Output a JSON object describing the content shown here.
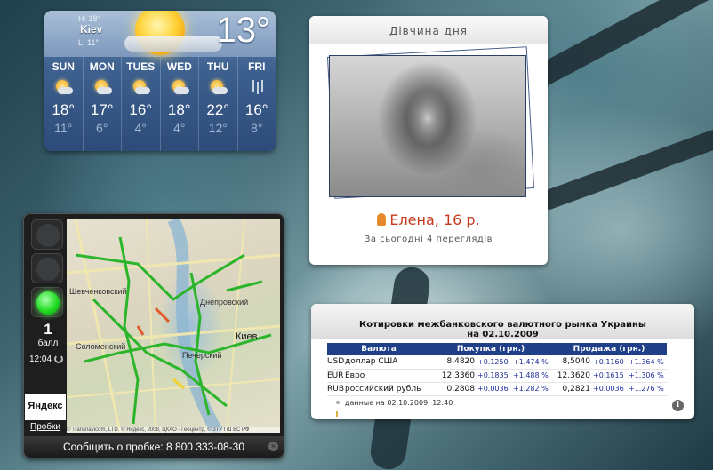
{
  "weather": {
    "high": "H: 18°",
    "city": "Kiev",
    "low": "L: 11°",
    "current_temp": "13°",
    "days": [
      {
        "name": "SUN",
        "icon": "sun-cloud-icon",
        "hi": "18°",
        "lo": "11°"
      },
      {
        "name": "MON",
        "icon": "sun-cloud-icon",
        "hi": "17°",
        "lo": "6°"
      },
      {
        "name": "TUES",
        "icon": "sun-cloud-icon",
        "hi": "16°",
        "lo": "4°"
      },
      {
        "name": "WED",
        "icon": "sun-cloud-icon",
        "hi": "18°",
        "lo": "4°"
      },
      {
        "name": "THU",
        "icon": "sun-cloud-icon",
        "hi": "22°",
        "lo": "12°"
      },
      {
        "name": "FRI",
        "icon": "rain-icon",
        "hi": "16°",
        "lo": "8°"
      }
    ]
  },
  "girl": {
    "title": "Дівчина дня",
    "name": "Елена, 16 р.",
    "views": "За сьогодні 4 переглядів"
  },
  "traffic": {
    "score": "1",
    "score_label": "балл",
    "time": "12:04",
    "yandex_logo": "Яндекс",
    "probki_link": "Пробки",
    "report": "Сообщить о пробке: 8 800 333-08-30",
    "map_labels": {
      "city": "Киев",
      "dneprovsky": "Днепровский",
      "pechersky": "Печерский",
      "solomensky": "Соломенский",
      "shevchenkovsky": "Шевченковский"
    },
    "map_copyright": "© Transnavicom, LTD. © Яндекс, 2008, ЦКАО - Геоцентр, © ЗТУ ГШ ВС РФ"
  },
  "currency": {
    "title_line1": "Котировки межбанковского валютного рынка Украины",
    "title_line2": "на 02.10.2009",
    "headers": [
      "Валюта",
      "Покупка (грн.)",
      "Продажа (грн.)"
    ],
    "rows": [
      {
        "code": "USD",
        "name": "доллар США",
        "buy": "8,4820",
        "buy_ch": "+0.1250",
        "buy_pct": "+1.474 %",
        "sell": "8,5040",
        "sell_ch": "+0.1160",
        "sell_pct": "+1.364 %"
      },
      {
        "code": "EUR",
        "name": "Евро",
        "buy": "12,3360",
        "buy_ch": "+0.1835",
        "buy_pct": "+1.488 %",
        "sell": "12,3620",
        "sell_ch": "+0.1615",
        "sell_pct": "+1.306 %"
      },
      {
        "code": "RUB",
        "name": "российский рубль",
        "buy": "0,2808",
        "buy_ch": "+0.0036",
        "buy_pct": "+1.282 %",
        "sell": "0,2821",
        "sell_ch": "+0.0036",
        "sell_pct": "+1.276 %"
      }
    ],
    "note": "данные на  02.10.2009,  12:40",
    "info_icon": "i"
  }
}
